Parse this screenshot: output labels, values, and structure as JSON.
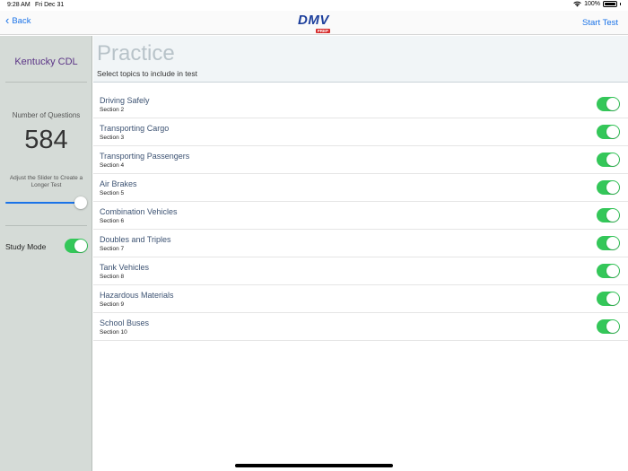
{
  "status_bar": {
    "time": "9:28 AM",
    "date": "Fri Dec 31",
    "battery": "100%",
    "wifi_icon": "wifi-icon",
    "battery_icon": "battery-icon"
  },
  "nav": {
    "back_label": "Back",
    "logo_text": "DMV",
    "logo_badge": "PREP",
    "start_label": "Start Test"
  },
  "sidebar": {
    "title": "Kentucky CDL",
    "questions_label": "Number of Questions",
    "questions_value": "584",
    "slider_hint": "Adjust the Slider to Create a Longer Test",
    "slider_level": 1.0,
    "study_mode_label": "Study Mode",
    "study_mode_on": true
  },
  "main": {
    "title": "Practice",
    "subtitle": "Select topics to include in test",
    "topics": [
      {
        "name": "Driving Safely",
        "section": "Section 2",
        "enabled": true
      },
      {
        "name": "Transporting Cargo",
        "section": "Section 3",
        "enabled": true
      },
      {
        "name": "Transporting Passengers",
        "section": "Section 4",
        "enabled": true
      },
      {
        "name": "Air Brakes",
        "section": "Section 5",
        "enabled": true
      },
      {
        "name": "Combination Vehicles",
        "section": "Section 6",
        "enabled": true
      },
      {
        "name": "Doubles and Triples",
        "section": "Section 7",
        "enabled": true
      },
      {
        "name": "Tank Vehicles",
        "section": "Section 8",
        "enabled": true
      },
      {
        "name": "Hazardous Materials",
        "section": "Section 9",
        "enabled": true
      },
      {
        "name": "School Buses",
        "section": "Section 10",
        "enabled": true
      }
    ]
  },
  "colors": {
    "accent": "#1a73e8",
    "toggle_on": "#34c759",
    "sidebar_bg": "#d5dbd7",
    "sidebar_title": "#5b3486"
  }
}
